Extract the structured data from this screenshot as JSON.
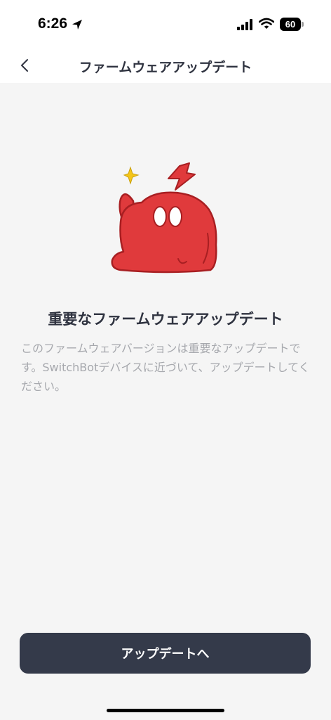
{
  "status_bar": {
    "time": "6:26",
    "battery": "60"
  },
  "nav": {
    "title": "ファームウェアアップデート"
  },
  "content": {
    "heading": "重要なファームウェアアップデート",
    "description": "このファームウェアバージョンは重要なアップデートです。SwitchBotデバイスに近づいて、アップデートしてください。"
  },
  "actions": {
    "update_label": "アップデートへ"
  },
  "colors": {
    "accent": "#343a4a",
    "mascot": "#e03a3c",
    "sparkle": "#f5c518"
  }
}
